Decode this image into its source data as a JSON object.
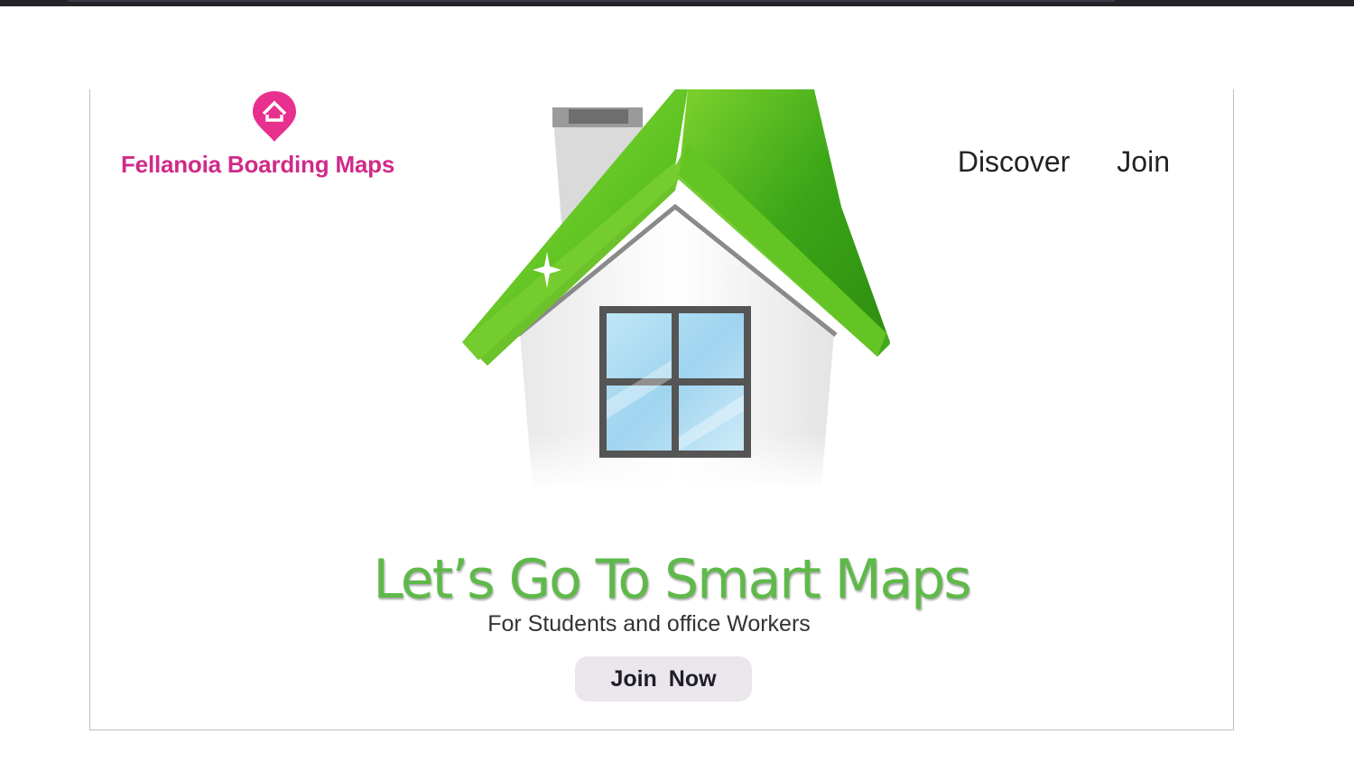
{
  "brand": {
    "name": "Fellanoia Boarding Maps",
    "logo_icon": "location-pin-home-icon",
    "color": "#d02a8a"
  },
  "nav": {
    "items": [
      {
        "label": "Discover"
      },
      {
        "label": "Join"
      }
    ]
  },
  "hero": {
    "image": "house-illustration",
    "headline": "Let’s Go To Smart Maps",
    "subtitle": "For Students and office Workers",
    "cta_label": "Join  Now",
    "headline_color": "#5fb94a",
    "roof_color": "#4caf2f"
  }
}
